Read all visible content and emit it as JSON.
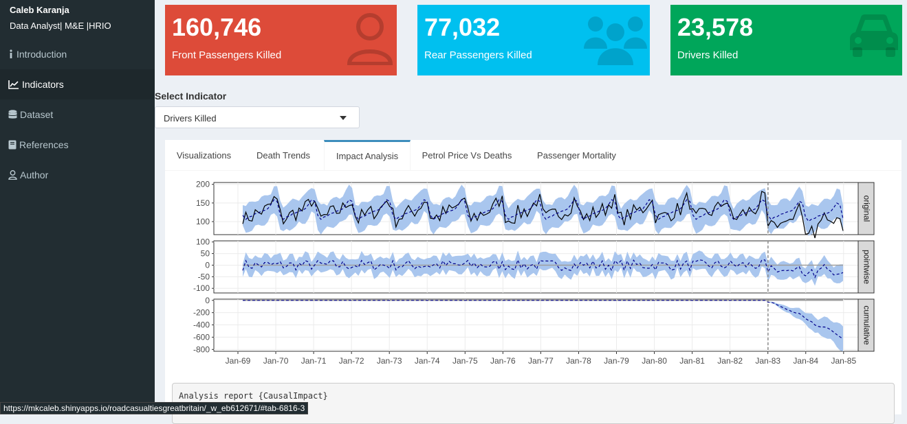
{
  "sidebar": {
    "user_name": "Caleb Karanja",
    "user_role": "Data Analyst| M&E |HRIO",
    "items": [
      {
        "label": "Introduction",
        "icon": "info-icon"
      },
      {
        "label": "Indicators",
        "icon": "line-chart-icon"
      },
      {
        "label": "Dataset",
        "icon": "database-icon"
      },
      {
        "label": "References",
        "icon": "book-icon"
      },
      {
        "label": "Author",
        "icon": "user-icon"
      }
    ]
  },
  "value_boxes": [
    {
      "value": "160,746",
      "label": "Front Passengers Killed",
      "color": "#dd4b39",
      "icon": "user-icon"
    },
    {
      "value": "77,032",
      "label": "Rear Passengers Killed",
      "color": "#00c0ef",
      "icon": "users-icon"
    },
    {
      "value": "23,578",
      "label": "Drivers Killed",
      "color": "#00a65a",
      "icon": "car-icon"
    }
  ],
  "selector": {
    "label": "Select Indicator",
    "value": "Drivers Killed"
  },
  "tabs": [
    {
      "label": "Visualizations"
    },
    {
      "label": "Death Trends"
    },
    {
      "label": "Impact Analysis"
    },
    {
      "label": "Petrol Price Vs Deaths"
    },
    {
      "label": "Passenger Mortality"
    }
  ],
  "chart_data": {
    "type": "line",
    "x_ticks": [
      "Jan-69",
      "Jan-70",
      "Jan-71",
      "Jan-72",
      "Jan-73",
      "Jan-74",
      "Jan-75",
      "Jan-76",
      "Jan-77",
      "Jan-78",
      "Jan-79",
      "Jan-80",
      "Jan-81",
      "Jan-82",
      "Jan-83",
      "Jan-84",
      "Jan-85"
    ],
    "intervention": "Jan-83",
    "panels": [
      {
        "name": "original",
        "ylim": [
          65,
          205
        ],
        "y_ticks": [
          100,
          150,
          200
        ]
      },
      {
        "name": "pointwise",
        "ylim": [
          -120,
          105
        ],
        "y_ticks": [
          -100,
          -50,
          0,
          50,
          100
        ]
      },
      {
        "name": "cumulative",
        "ylim": [
          -830,
          20
        ],
        "y_ticks": [
          -800,
          -600,
          -400,
          -200,
          0
        ]
      }
    ],
    "band_color": "#a9c6ee",
    "mean_color": "#00008b",
    "actual_color": "#000000"
  },
  "report": {
    "text": "Analysis report {CausalImpact}"
  },
  "status_url": "https://mkcaleb.shinyapps.io/roadcasualtiesgreatbritain/_w_eb612671/#tab-6816-3"
}
